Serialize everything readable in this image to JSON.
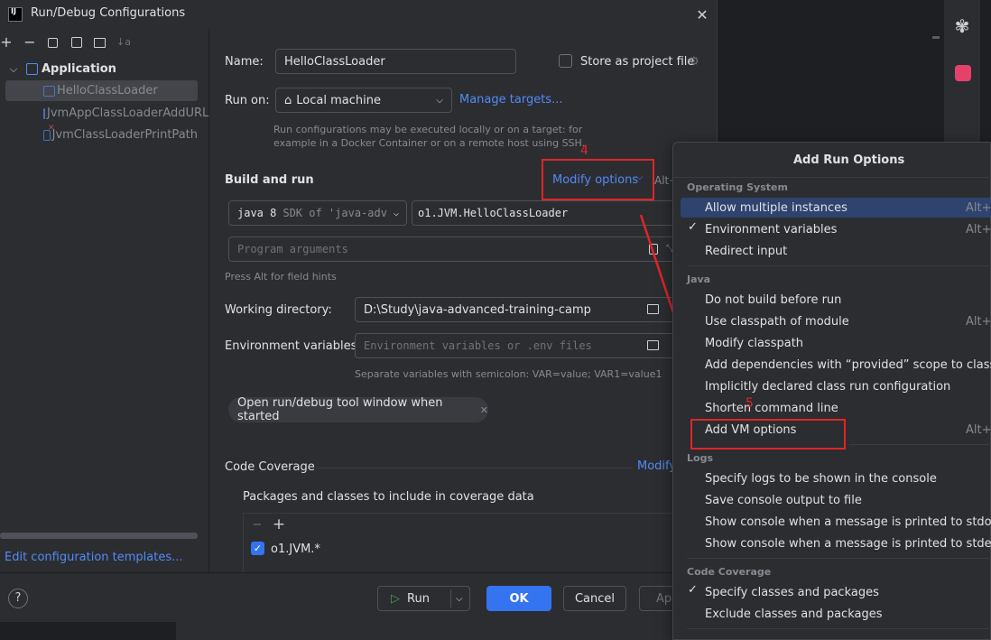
{
  "dialog": {
    "title": "Run/Debug Configurations",
    "left": {
      "group": "Application",
      "items": [
        "HelloClassLoader",
        "JvmAppClassLoaderAddURL",
        "JvmClassLoaderPrintPath"
      ],
      "edit_templates": "Edit configuration templates..."
    },
    "form": {
      "name_label": "Name:",
      "name_value": "HelloClassLoader",
      "store_label": "Store as project file",
      "run_on_label": "Run on:",
      "run_on_value": "Local machine",
      "manage_targets": "Manage targets...",
      "run_on_hint_1": "Run configurations may be executed locally or on a target: for",
      "run_on_hint_2": "example in a Docker Container or on a remote host using SSH.",
      "build_and_run": "Build and run",
      "modify_options": "Modify options",
      "modify_shortcut": "Alt+",
      "sdk_value": "java 8",
      "sdk_hint": "SDK of 'java-adv",
      "main_class": "o1.JVM.HelloClassLoader",
      "program_args_placeholder": "Program arguments",
      "alt_hint": "Press Alt for field hints",
      "workdir_label": "Working directory:",
      "workdir_value": "D:\\Study\\java-advanced-training-camp",
      "env_label": "Environment variables:",
      "env_placeholder": "Environment variables or .env files",
      "env_hint": "Separate variables with semicolon: VAR=value; VAR1=value1",
      "open_tool_window": "Open run/debug tool window when started",
      "code_coverage": "Code Coverage",
      "modify_partial": "Modify",
      "packages_label": "Packages and classes to include in coverage data",
      "package_item": "o1.JVM.*"
    },
    "footer": {
      "run": "Run",
      "ok": "OK",
      "cancel": "Cancel",
      "apply_partial": "Ap"
    }
  },
  "annotations": {
    "step4": "4",
    "step5": "5"
  },
  "popup": {
    "title": "Add Run Options",
    "sections": [
      {
        "header": "Operating System",
        "items": [
          {
            "label": "Allow multiple instances",
            "shortcut": "Alt+U",
            "checked": false,
            "selected": true
          },
          {
            "label": "Environment variables",
            "shortcut": "Alt+E",
            "checked": true
          },
          {
            "label": "Redirect input",
            "shortcut": "",
            "checked": false
          }
        ]
      },
      {
        "header": "Java",
        "items": [
          {
            "label": "Do not build before run",
            "shortcut": "",
            "checked": false
          },
          {
            "label": "Use classpath of module",
            "shortcut": "Alt+O",
            "checked": false
          },
          {
            "label": "Modify classpath",
            "shortcut": "",
            "checked": false
          },
          {
            "label": "Add dependencies with “provided” scope to classpath",
            "shortcut": "",
            "checked": false
          },
          {
            "label": "Implicitly declared class run configuration",
            "shortcut": "",
            "checked": false
          },
          {
            "label": "Shorten command line",
            "shortcut": "",
            "checked": false
          },
          {
            "label": "Add VM options",
            "shortcut": "Alt+V",
            "checked": false
          }
        ]
      },
      {
        "header": "Logs",
        "items": [
          {
            "label": "Specify logs to be shown in the console",
            "shortcut": "",
            "checked": false
          },
          {
            "label": "Save console output to file",
            "shortcut": "",
            "checked": false
          },
          {
            "label": "Show console when a message is printed to stdout",
            "shortcut": "",
            "checked": false
          },
          {
            "label": "Show console when a message is printed to stderr",
            "shortcut": "",
            "checked": false
          }
        ]
      },
      {
        "header": "Code Coverage",
        "items": [
          {
            "label": "Specify classes and packages",
            "shortcut": "",
            "checked": true
          },
          {
            "label": "Exclude classes and packages",
            "shortcut": "",
            "checked": false
          }
        ]
      }
    ]
  },
  "colors": {
    "accent": "#3574f0",
    "link": "#548af7",
    "annotation": "#e0252a"
  }
}
